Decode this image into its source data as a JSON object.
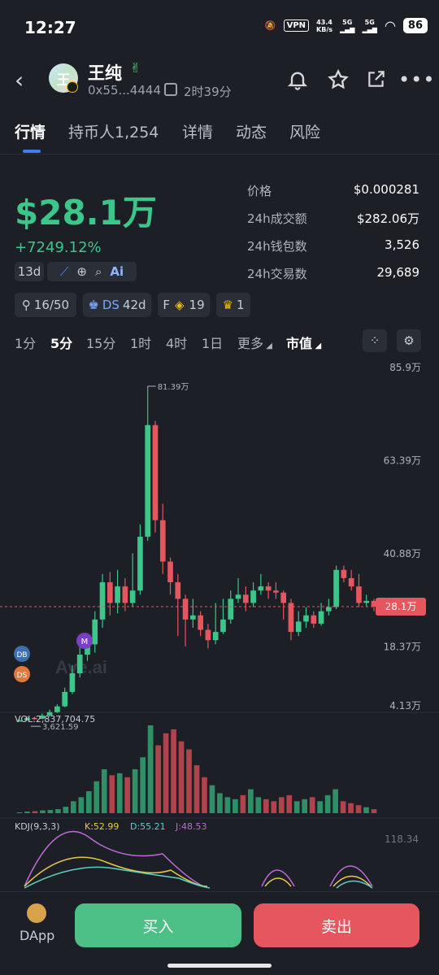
{
  "status_bar": {
    "time": "12:27",
    "vpn": "VPN",
    "net_speed_top": "43.4",
    "net_speed_bottom": "KB/s",
    "sig1": "5G",
    "sig2": "5G",
    "battery": "86"
  },
  "token": {
    "avatar_char": "王",
    "name": "王纯",
    "address": "0x55...4444",
    "age": "2时39分"
  },
  "tabs": [
    "行情",
    "持币人1,254",
    "详情",
    "动态",
    "风险"
  ],
  "summary": {
    "market_cap": "$28.1万",
    "change": "+7249.12%",
    "age_chip": "13d",
    "stats": [
      {
        "label": "价格",
        "value": "$0.000281"
      },
      {
        "label": "24h成交额",
        "value": "$282.06万"
      },
      {
        "label": "24h钱包数",
        "value": "3,526"
      },
      {
        "label": "24h交易数",
        "value": "29,689"
      }
    ],
    "badges": {
      "holders": "16/50",
      "ds_label": "DS",
      "ds_value": "42d",
      "f_label": "F",
      "f_value": "19",
      "trophy_value": "1"
    }
  },
  "timeframes": [
    "1分",
    "5分",
    "15分",
    "1时",
    "4时",
    "1日",
    "更多",
    "市值"
  ],
  "chart_data": {
    "type": "candlestick",
    "y_ticks": [
      "85.9万",
      "63.39万",
      "40.88万",
      "18.37万",
      "4.13万"
    ],
    "y_tick_values": [
      85.9,
      63.39,
      40.88,
      18.37,
      4.13
    ],
    "current_label": "28.1万",
    "current_value": 28.1,
    "high_label": "81.39万",
    "high_value": 81.39,
    "low_label": "3,621.59",
    "low_value": 0.362,
    "watermark": "Ave.ai",
    "candles": [
      {
        "o": 0.4,
        "c": 0.6,
        "h": 0.9,
        "l": 0.36
      },
      {
        "o": 0.6,
        "c": 1.2,
        "h": 1.6,
        "l": 0.5
      },
      {
        "o": 1.2,
        "c": 1.0,
        "h": 1.5,
        "l": 0.8
      },
      {
        "o": 1.0,
        "c": 1.8,
        "h": 2.3,
        "l": 0.9
      },
      {
        "o": 1.8,
        "c": 2.6,
        "h": 3.2,
        "l": 1.6
      },
      {
        "o": 2.6,
        "c": 4.0,
        "h": 4.5,
        "l": 2.4
      },
      {
        "o": 4.0,
        "c": 7.5,
        "h": 8.5,
        "l": 3.8
      },
      {
        "o": 7.5,
        "c": 12.0,
        "h": 14.0,
        "l": 7.0
      },
      {
        "o": 12.0,
        "c": 16.5,
        "h": 18.5,
        "l": 11.0
      },
      {
        "o": 16.5,
        "c": 19.0,
        "h": 21.0,
        "l": 15.0
      },
      {
        "o": 19.0,
        "c": 25.0,
        "h": 27.0,
        "l": 17.0
      },
      {
        "o": 25.0,
        "c": 34.0,
        "h": 36.0,
        "l": 23.0
      },
      {
        "o": 34.0,
        "c": 29.0,
        "h": 36.5,
        "l": 26.0
      },
      {
        "o": 29.0,
        "c": 33.0,
        "h": 37.0,
        "l": 26.5
      },
      {
        "o": 33.0,
        "c": 29.0,
        "h": 35.0,
        "l": 27.0
      },
      {
        "o": 29.0,
        "c": 32.0,
        "h": 41.0,
        "l": 28.0
      },
      {
        "o": 32.0,
        "c": 45.0,
        "h": 48.0,
        "l": 31.0
      },
      {
        "o": 45.0,
        "c": 72.0,
        "h": 81.39,
        "l": 44.0
      },
      {
        "o": 72.0,
        "c": 49.0,
        "h": 73.0,
        "l": 46.0
      },
      {
        "o": 49.0,
        "c": 39.0,
        "h": 53.0,
        "l": 36.0
      },
      {
        "o": 39.0,
        "c": 34.0,
        "h": 40.0,
        "l": 31.0
      },
      {
        "o": 34.0,
        "c": 30.0,
        "h": 36.0,
        "l": 21.0
      },
      {
        "o": 30.0,
        "c": 25.0,
        "h": 31.0,
        "l": 18.5
      },
      {
        "o": 25.0,
        "c": 26.0,
        "h": 30.0,
        "l": 23.0
      },
      {
        "o": 26.0,
        "c": 22.5,
        "h": 27.0,
        "l": 21.0
      },
      {
        "o": 22.5,
        "c": 20.0,
        "h": 24.0,
        "l": 18.0
      },
      {
        "o": 20.0,
        "c": 22.0,
        "h": 29.0,
        "l": 19.0
      },
      {
        "o": 22.0,
        "c": 25.0,
        "h": 30.0,
        "l": 21.5
      },
      {
        "o": 25.0,
        "c": 30.0,
        "h": 32.0,
        "l": 24.0
      },
      {
        "o": 30.0,
        "c": 31.0,
        "h": 35.0,
        "l": 29.0
      },
      {
        "o": 31.0,
        "c": 29.0,
        "h": 33.0,
        "l": 27.0
      },
      {
        "o": 29.0,
        "c": 32.0,
        "h": 34.0,
        "l": 28.0
      },
      {
        "o": 32.0,
        "c": 33.0,
        "h": 36.0,
        "l": 31.0
      },
      {
        "o": 33.0,
        "c": 32.0,
        "h": 34.0,
        "l": 30.0
      },
      {
        "o": 32.0,
        "c": 31.5,
        "h": 34.0,
        "l": 30.0
      },
      {
        "o": 31.5,
        "c": 29.0,
        "h": 32.0,
        "l": 25.0
      },
      {
        "o": 29.0,
        "c": 22.0,
        "h": 30.0,
        "l": 20.0
      },
      {
        "o": 22.0,
        "c": 24.5,
        "h": 27.0,
        "l": 21.0
      },
      {
        "o": 24.5,
        "c": 26.0,
        "h": 28.0,
        "l": 23.0
      },
      {
        "o": 26.0,
        "c": 24.0,
        "h": 27.0,
        "l": 23.0
      },
      {
        "o": 24.0,
        "c": 27.0,
        "h": 29.0,
        "l": 23.5
      },
      {
        "o": 27.0,
        "c": 28.0,
        "h": 30.0,
        "l": 26.0
      },
      {
        "o": 28.0,
        "c": 37.0,
        "h": 38.0,
        "l": 27.5
      },
      {
        "o": 37.0,
        "c": 35.0,
        "h": 38.0,
        "l": 34.0
      },
      {
        "o": 35.0,
        "c": 33.0,
        "h": 37.0,
        "l": 32.0
      },
      {
        "o": 33.0,
        "c": 29.0,
        "h": 36.0,
        "l": 28.0
      },
      {
        "o": 29.0,
        "c": 29.5,
        "h": 31.0,
        "l": 28.0
      },
      {
        "o": 29.5,
        "c": 28.1,
        "h": 30.0,
        "l": 27.0
      }
    ],
    "volume_label": "VOL:2,837,704.75",
    "volume": [
      2,
      4,
      5,
      7,
      8,
      10,
      16,
      30,
      40,
      55,
      80,
      110,
      95,
      100,
      90,
      110,
      140,
      220,
      170,
      200,
      210,
      180,
      160,
      120,
      90,
      70,
      50,
      40,
      35,
      45,
      60,
      40,
      35,
      30,
      40,
      45,
      30,
      35,
      40,
      30,
      45,
      60,
      30,
      25,
      20,
      15,
      10
    ],
    "kdj_label": "KDJ(9,3,3)",
    "kdj": {
      "K": "K:52.99",
      "D": "D:55.21",
      "J": "J:48.53"
    },
    "kdj_top": "118.34"
  },
  "colors": {
    "up": "#3cc68a",
    "down": "#e5565f",
    "accent": "#3f7ff0",
    "bg": "#1c1f26"
  },
  "actions": {
    "dapp": "DApp",
    "buy": "买入",
    "sell": "卖出"
  }
}
